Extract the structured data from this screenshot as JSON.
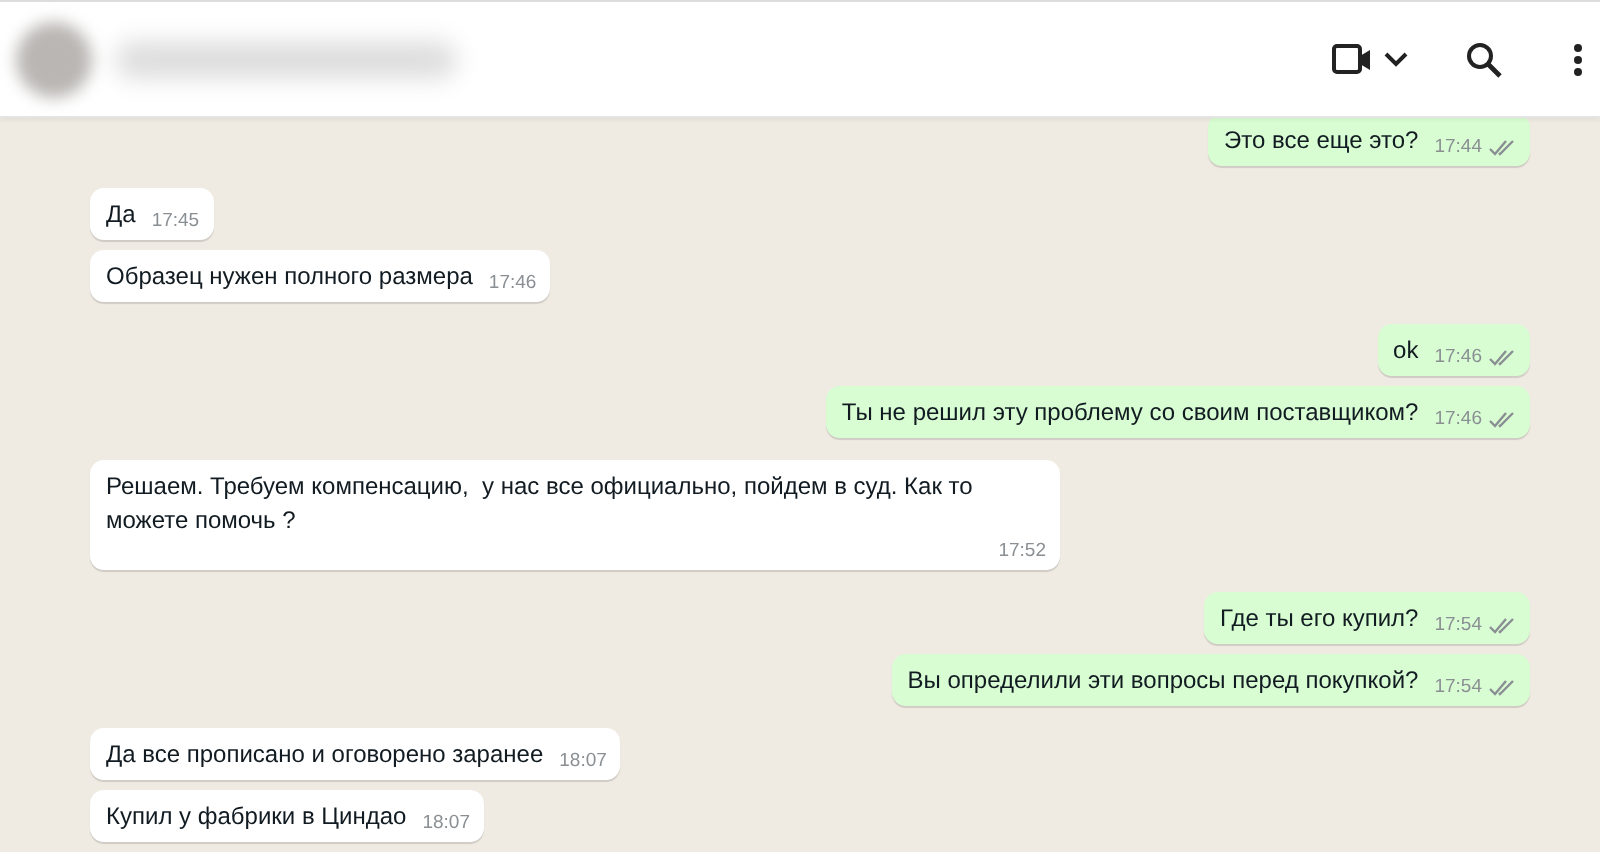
{
  "groups": [
    {
      "outgoing": true,
      "messages": [
        {
          "text": "Это все еще это?",
          "time": "17:44",
          "read": false
        }
      ]
    },
    {
      "outgoing": false,
      "messages": [
        {
          "text": "Да",
          "time": "17:45"
        },
        {
          "text": "Образец нужен полного размера",
          "time": "17:46"
        }
      ]
    },
    {
      "outgoing": true,
      "messages": [
        {
          "text": "ok",
          "time": "17:46",
          "read": false
        },
        {
          "text": "Ты не решил эту проблему со своим поставщиком?",
          "time": "17:46",
          "read": false
        }
      ]
    },
    {
      "outgoing": false,
      "messages": [
        {
          "text": "Решаем. Требуем компенсацию,  у нас все официально, пойдем в суд. Как то можете помочь ?",
          "time": "17:52"
        }
      ]
    },
    {
      "outgoing": true,
      "messages": [
        {
          "text": "Где ты его купил?",
          "time": "17:54",
          "read": false
        },
        {
          "text": "Вы определили эти вопросы перед покупкой?",
          "time": "17:54",
          "read": false
        }
      ]
    },
    {
      "outgoing": false,
      "messages": [
        {
          "text": "Да все прописано и оговорено заранее",
          "time": "18:07"
        },
        {
          "text": "Купил у фабрики в Циндао",
          "time": "18:07"
        }
      ]
    }
  ]
}
